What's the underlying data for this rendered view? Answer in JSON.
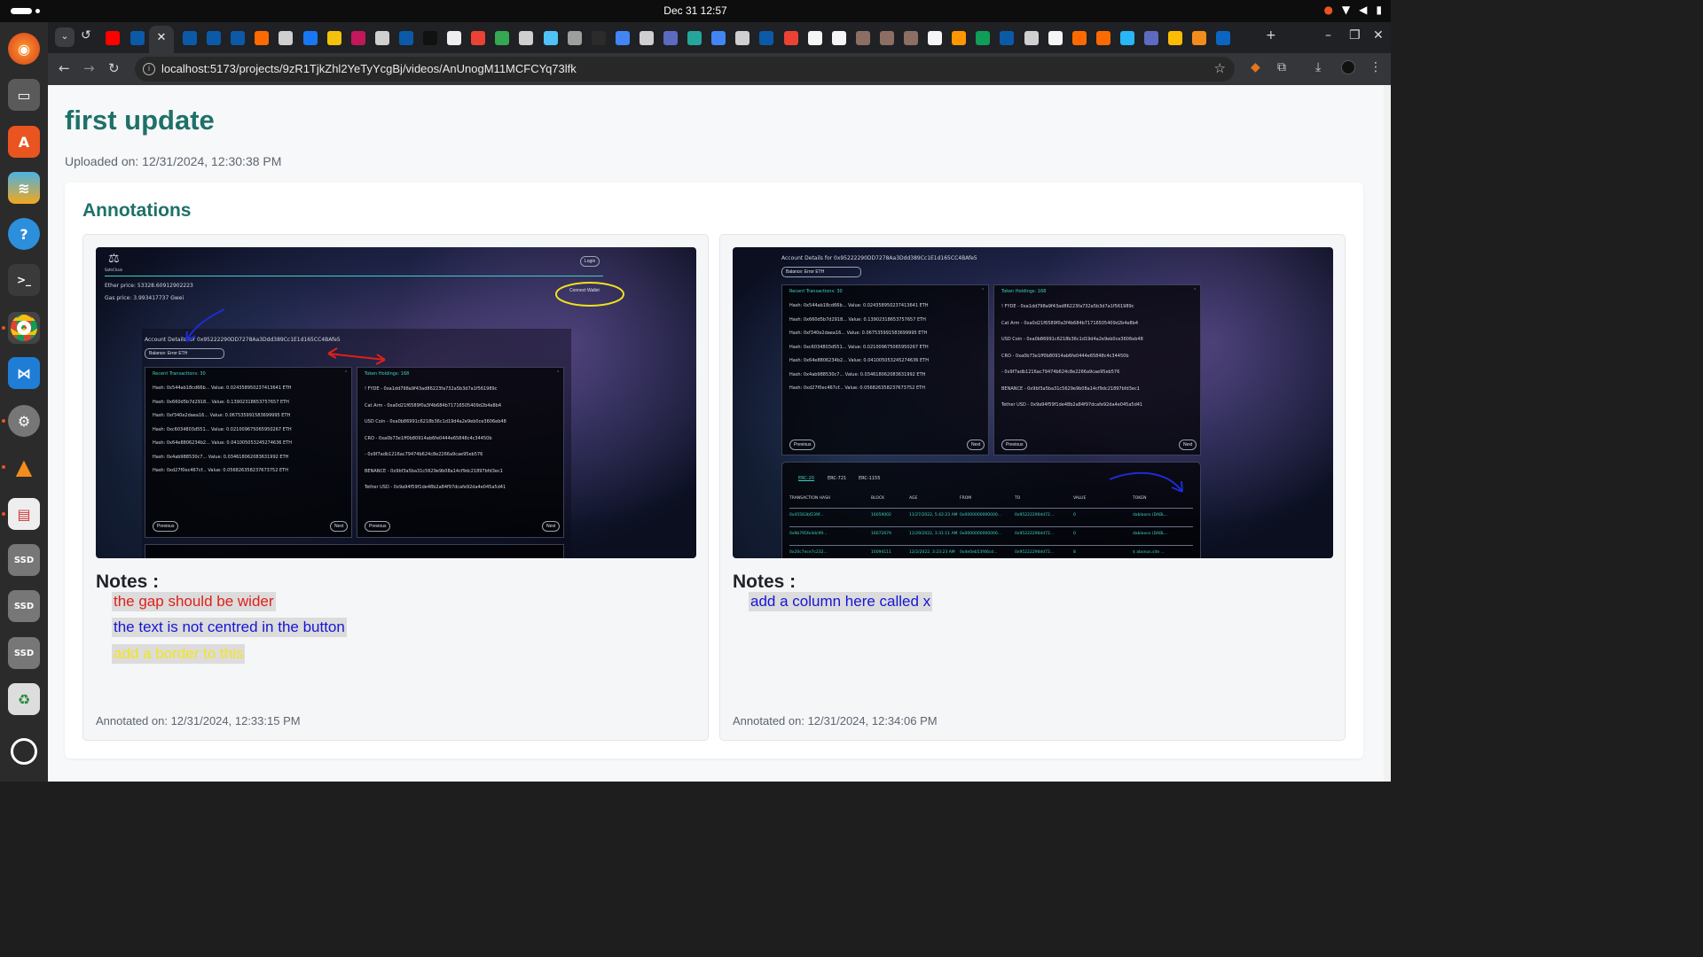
{
  "system": {
    "clock": "Dec 31  12:57"
  },
  "browser": {
    "url": "localhost:5173/projects/9zR1TjkZhl2YeTyYcgBj/videos/AnUnogM11MCFCYq73lfk",
    "current_tab_close": "✕"
  },
  "page": {
    "title": "first update",
    "uploaded": "Uploaded on: 12/31/2024, 12:30:38 PM",
    "annotations_heading": "Annotations"
  },
  "annotations": [
    {
      "notes_heading": "Notes :",
      "notes": [
        {
          "text": "the gap should be wider",
          "color": "#e0201b"
        },
        {
          "text": "the text is not centred in the button",
          "color": "#1515d8"
        },
        {
          "text": "add a border to this",
          "color": "#f4e41c"
        }
      ],
      "annotated_on": "Annotated on: 12/31/2024, 12:33:15 PM",
      "screenshot": {
        "logo": "SafeChain",
        "login": "Login",
        "connect_wallet": "Connect Wallet",
        "ether_price": "Ether price: 53328.60912902223",
        "gas_price": "Gas price: 3.993417737 Gwei",
        "account_details": "Account Details for 0x95222290DD7278Aa3Ddd389Cc1E1d165CC4BAfe5",
        "balance": "Balance: Error ETH",
        "recent_tx_title": "Recent Transactions: 30",
        "token_holdings_title": "Token Holdings: 168",
        "transactions": [
          "Hash: 0x544ab18cd66b... Value: 0.024358950237413641 ETH",
          "Hash: 0x660d5b7d2918... Value: 0.13902318653757657 ETH",
          "Hash: 0xf340e2daea16... Value: 0.067535991583699995 ETH",
          "Hash: 0xc6034803d551... Value: 0.021009675065950267 ETH",
          "Hash: 0x64e8806234b2... Value: 0.041005053245274636 ETH",
          "Hash: 0x4ab988530c7... Value: 0.034618062083631992 ETH",
          "Hash: 0xd27f0ec467cf... Value: 0.056826358237673752 ETH"
        ],
        "tokens": [
          "! FYDE - 0xa1dd798a9f43ad86223fa732a5b3d7a1f561989c",
          "Cat Arm - 0xa0d21f6589f0a3f4b684b71716505409d2b4e8b4",
          "USD Coin - 0xa0b86991c6218b36c1d19d4a2e9eb0ce3606eb48",
          "CRO - 0xa0b73e1ff0b80914ab6fe0444e65848c4c34450b",
          "- 0x9f7adb1216ac79474b624c8e2266a9cae95eb576",
          "BENANCE - 0x9bf3a5ba31c5629e9b08a14cf9dc21897bfd3ec1",
          "Tether USD - 0x9a94f59f1de48b2a84f97dcafe92da4e045a5d41"
        ],
        "previous": "Previous",
        "next": "Next"
      }
    },
    {
      "notes_heading": "Notes :",
      "notes": [
        {
          "text": "add a column here called x",
          "color": "#1515d8"
        }
      ],
      "annotated_on": "Annotated on: 12/31/2024, 12:34:06 PM",
      "screenshot": {
        "account_details": "Account Details for 0x95222290DD7278Aa3Ddd389Cc1E1d165CC4BAfe5",
        "balance": "Balance: Error ETH",
        "recent_tx_title": "Recent Transactions: 30",
        "token_holdings_title": "Token Holdings: 168",
        "transactions": [
          "Hash: 0x544ab18cd66b... Value: 0.024358950237413641 ETH",
          "Hash: 0x660d5b7d2918... Value: 0.13902318653757657 ETH",
          "Hash: 0xf340e2daea16... Value: 0.067535991583699995 ETH",
          "Hash: 0xc6034803d551... Value: 0.021009675065950267 ETH",
          "Hash: 0x64e8806234b2... Value: 0.041005053245274636 ETH",
          "Hash: 0x4ab988530c7... Value: 0.034618062083631992 ETH",
          "Hash: 0xd27f0ec467cf... Value: 0.056826358237673752 ETH"
        ],
        "tokens": [
          "! FYDE - 0xa1dd798a9f43ad86223fa732a5b3d7a1f561989c",
          "Cat Arm - 0xa0d21f6589f0a3f4b684b71716505409d2b4e8b4",
          "USD Coin - 0xa0b86991c6218b36c1d19d4a2e9eb0ce3606eb48",
          "CRO - 0xa0b73e1ff0b80914ab6fe0444e65848c4c34450b",
          "- 0x9f7adb1216ac79474b624c8e2266a9cae95eb576",
          "BENANCE - 0x9bf3a5ba31c5629e9b08a14cf9dc21897bfd3ec1",
          "Tether USD - 0x9a94f59f1de48b2a84f97dcafe92da4e045a5d41"
        ],
        "previous": "Previous",
        "next": "Next",
        "tabs": [
          "ERC-20",
          "ERC-721",
          "ERC-1155"
        ],
        "table_headers": [
          "TRANSACTION HASH",
          "BLOCK",
          "AGE",
          "FROM",
          "TO",
          "VALUE",
          "TOKEN"
        ],
        "table_rows": [
          [
            "0x45563bf239f...",
            "16059002",
            "11/27/2022, 5:42:23 AM",
            "0x0000000000000...",
            "0x95222290dd72...",
            "0",
            "dabloons (DABL..."
          ],
          [
            "0x9b795fe4dc99...",
            "16072679",
            "11/29/2022, 3:31:11 AM",
            "0x0000000000000...",
            "0x95222290dd72...",
            "0",
            "dabloons (DABL..."
          ],
          [
            "0x20c7ece7c232...",
            "16094111",
            "12/2/2022, 3:23:23 AM",
            "0x4e0eb53f46cd...",
            "0x95222290dd72...",
            "8",
            "$ abonus.site ..."
          ]
        ]
      }
    }
  ]
}
